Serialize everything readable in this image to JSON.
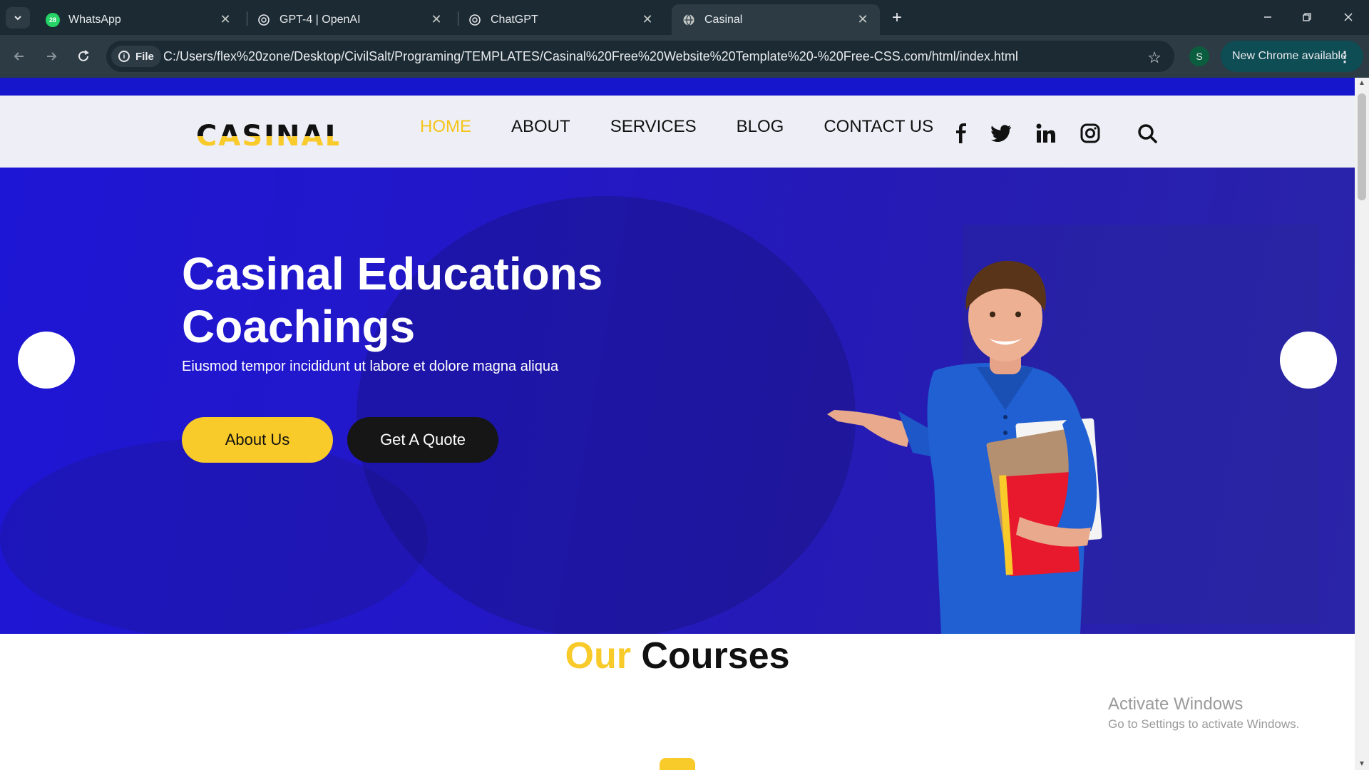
{
  "browser": {
    "tabs": [
      {
        "title": "WhatsApp",
        "badge": "28"
      },
      {
        "title": "GPT-4 | OpenAI"
      },
      {
        "title": "ChatGPT"
      },
      {
        "title": "Casinal"
      }
    ],
    "address": {
      "chip": "File",
      "url": "C:/Users/flex%20zone/Desktop/CivilSalt/Programing/TEMPLATES/Casinal%20Free%20Website%20Template%20-%20Free-CSS.com/html/index.html"
    },
    "profile_initial": "S",
    "update_label": "New Chrome available"
  },
  "site": {
    "logo": "CASINAL",
    "nav": [
      "HOME",
      "ABOUT",
      "SERVICES",
      "BLOG",
      "CONTACT US"
    ],
    "active_nav": "HOME",
    "social_icons": [
      "facebook-icon",
      "twitter-icon",
      "linkedin-icon",
      "instagram-icon"
    ],
    "hero": {
      "title_line1": "Casinal Educations",
      "title_line2": "Coachings",
      "subtitle": "Eiusmod tempor incididunt ut labore et dolore magna aliqua",
      "btn_about": "About Us",
      "btn_quote": "Get A Quote"
    },
    "courses": {
      "accent": "Our",
      "rest": "Courses"
    }
  },
  "os": {
    "activate_title": "Activate Windows",
    "activate_sub": "Go to Settings to activate Windows."
  },
  "colors": {
    "brand_blue": "#1d16d4",
    "accent_yellow": "#f8ca2a",
    "chrome_dark": "#1b2a33"
  }
}
